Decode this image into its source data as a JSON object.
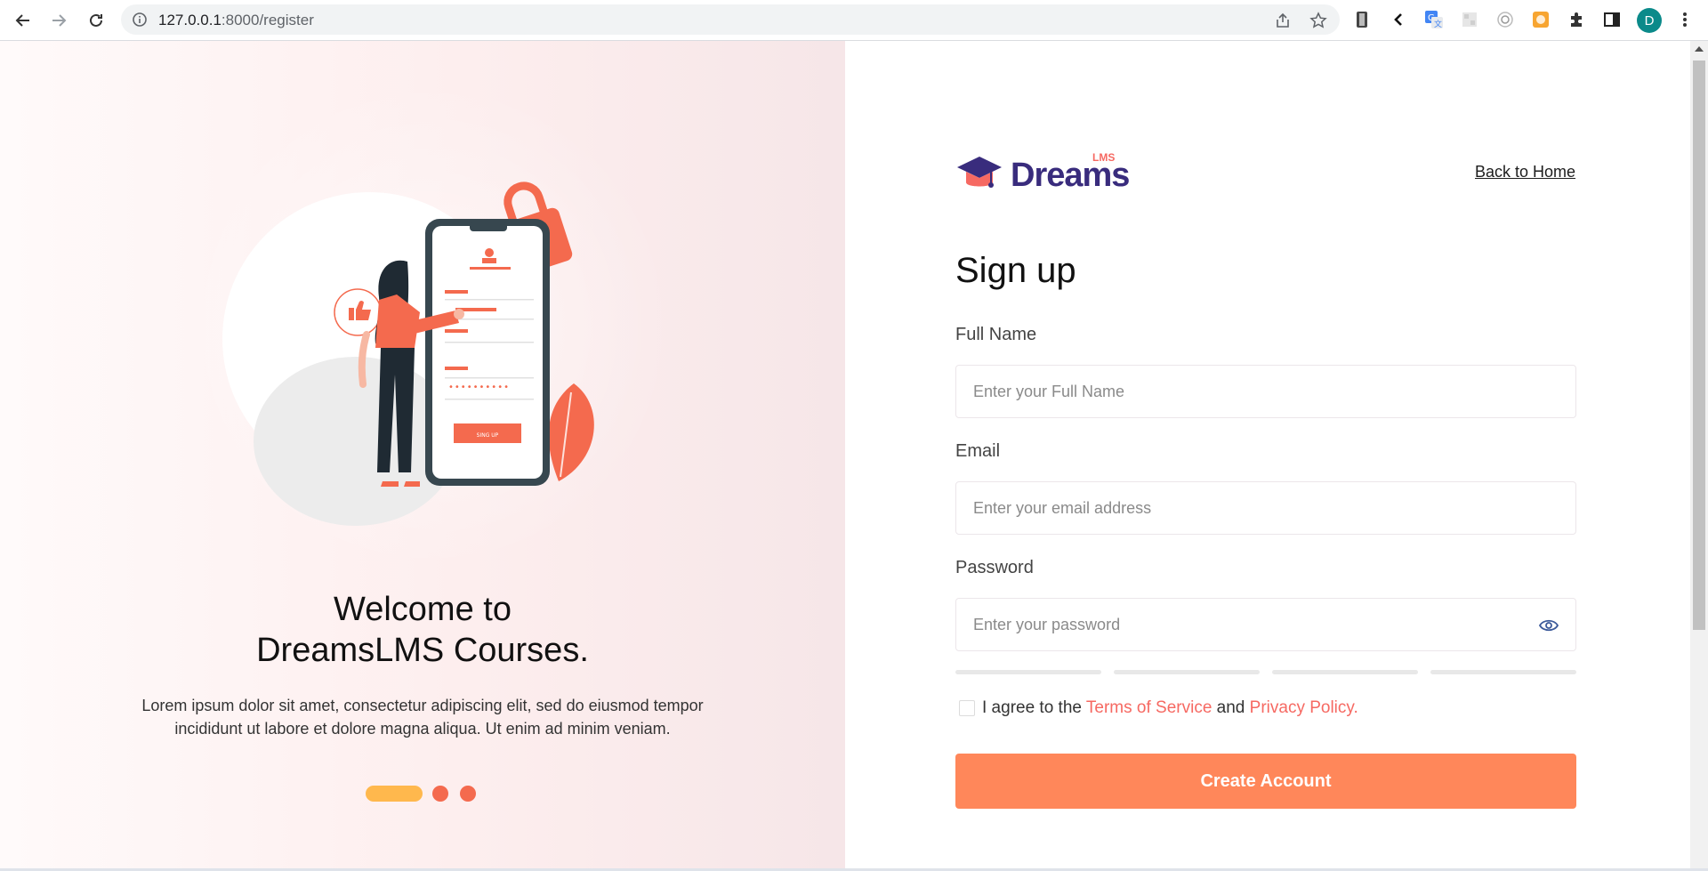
{
  "browser": {
    "url_host": "127.0.0.1",
    "url_rest": ":8000/register",
    "profile_initial": "D"
  },
  "left": {
    "welcome_line1": "Welcome to",
    "welcome_line2": "DreamsLMS Courses.",
    "description_line1": "Lorem ipsum dolor sit amet, consectetur adipiscing elit, sed do eiusmod tempor",
    "description_line2": "incididunt ut labore et dolore magna aliqua. Ut enim ad minim veniam.",
    "illustration_button_label": "SING UP"
  },
  "header": {
    "logo_text": "Dreams",
    "logo_sup": "LMS",
    "back_link": "Back to Home"
  },
  "form": {
    "title": "Sign up",
    "full_name_label": "Full Name",
    "full_name_placeholder": "Enter your Full Name",
    "email_label": "Email",
    "email_placeholder": "Enter your email address",
    "password_label": "Password",
    "password_placeholder": "Enter your password",
    "agree_prefix": "I agree to the",
    "terms_link": "Terms of Service",
    "agree_and": "and",
    "privacy_link": "Privacy Policy.",
    "submit_label": "Create Account"
  },
  "colors": {
    "accent": "#ff875a",
    "link": "#f66962",
    "brand": "#392c7d",
    "slider_active": "#ffb84d"
  },
  "slider": {
    "active_index": 0,
    "count": 3
  }
}
